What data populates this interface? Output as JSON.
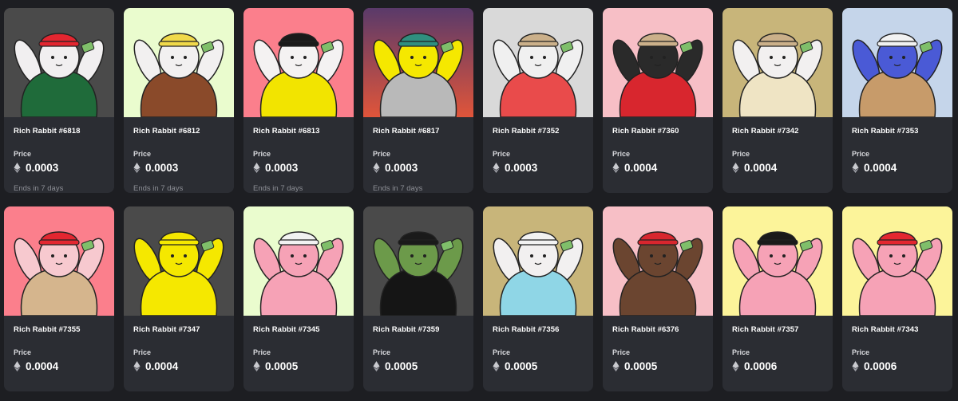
{
  "price_label": "Price",
  "currency_icon": "ethereum-icon",
  "cards": [
    {
      "name": "Rich Rabbit #6818",
      "price": "0.0003",
      "ends": "Ends in 7 days",
      "bg": "#4a4a4a",
      "body": "#f1eff0",
      "hat": "#e32630",
      "accessory": "green-varsity-jacket",
      "shirt": "#1f6b3a"
    },
    {
      "name": "Rich Rabbit #6812",
      "price": "0.0003",
      "ends": "Ends in 7 days",
      "bg": "#eafcce",
      "body": "#f2f0f0",
      "hat": "#f0d94a",
      "accessory": "flower-crown-painting",
      "shirt": "#8a4a2a"
    },
    {
      "name": "Rich Rabbit #6813",
      "price": "0.0003",
      "ends": "Ends in 7 days",
      "bg": "#fb7f8c",
      "body": "#f4f2f2",
      "hat": "#1a1a1a",
      "accessory": "yellow-puffer-jacket",
      "shirt": "#f2e400"
    },
    {
      "name": "Rich Rabbit #6817",
      "price": "0.0003",
      "ends": "Ends in 7 days",
      "bg": "#7a4a6a",
      "body": "#f5e800",
      "hat": "#2f8f7f",
      "accessory": "grey-tshirt",
      "shirt": "#b9b9b9"
    },
    {
      "name": "Rich Rabbit #7352",
      "price": "0.0003",
      "ends": "",
      "bg": "#d9d9d9",
      "body": "#f0f0f0",
      "hat": "#cbb08a",
      "accessory": "paint-splatter",
      "shirt": "#e94b4b"
    },
    {
      "name": "Rich Rabbit #7360",
      "price": "0.0004",
      "ends": "",
      "bg": "#f7bfc6",
      "body": "#2a2a2a",
      "hat": "#cbb08a",
      "accessory": "paint-splatter-dark",
      "shirt": "#d8262e"
    },
    {
      "name": "Rich Rabbit #7342",
      "price": "0.0004",
      "ends": "",
      "bg": "#c8b57a",
      "body": "#f2f0f0",
      "hat": "#cbb08a",
      "accessory": "cream-suit",
      "shirt": "#efe4c4"
    },
    {
      "name": "Rich Rabbit #7353",
      "price": "0.0004",
      "ends": "",
      "bg": "#c5d5ea",
      "body": "#4a5ad6",
      "hat": "#f2f2f2",
      "accessory": "tan-coat",
      "shirt": "#c79b6a"
    },
    {
      "name": "Rich Rabbit #7355",
      "price": "0.0004",
      "ends": "",
      "bg": "#fb7f8c",
      "body": "#f7c9cf",
      "hat": "#e32630",
      "accessory": "trench-coat",
      "shirt": "#d5b58d"
    },
    {
      "name": "Rich Rabbit #7347",
      "price": "0.0004",
      "ends": "",
      "bg": "#4a4a4a",
      "body": "#f5e800",
      "hat": "#f5e800",
      "accessory": "yellow-beanie",
      "shirt": "#f5e800"
    },
    {
      "name": "Rich Rabbit #7345",
      "price": "0.0005",
      "ends": "",
      "bg": "#eafcce",
      "body": "#f6a2b6",
      "hat": "#f2f2f2",
      "accessory": "pink-body",
      "shirt": "#f6a2b6"
    },
    {
      "name": "Rich Rabbit #7359",
      "price": "0.0005",
      "ends": "",
      "bg": "#4a4a4a",
      "body": "#6c9a4a",
      "hat": "#1a1a1a",
      "accessory": "spiked-jacket",
      "shirt": "#151515"
    },
    {
      "name": "Rich Rabbit #7356",
      "price": "0.0005",
      "ends": "",
      "bg": "#c8b57a",
      "body": "#f2f0f0",
      "hat": "#f2f2f2",
      "accessory": "blue-tshirt",
      "shirt": "#8fd6e6"
    },
    {
      "name": "Rich Rabbit #6376",
      "price": "0.0005",
      "ends": "",
      "bg": "#f7bfc6",
      "body": "#6b4530",
      "hat": "#d8262e",
      "accessory": "brown-body",
      "shirt": "#6b4530"
    },
    {
      "name": "Rich Rabbit #7357",
      "price": "0.0006",
      "ends": "",
      "bg": "#fcf49a",
      "body": "#f6a2b6",
      "hat": "#1a1a1a",
      "accessory": "pink-body",
      "shirt": "#f6a2b6"
    },
    {
      "name": "Rich Rabbit #7343",
      "price": "0.0006",
      "ends": "",
      "bg": "#fcf49a",
      "body": "#f6a2b6",
      "hat": "#e32630",
      "accessory": "pink-body",
      "shirt": "#f6a2b6"
    }
  ]
}
